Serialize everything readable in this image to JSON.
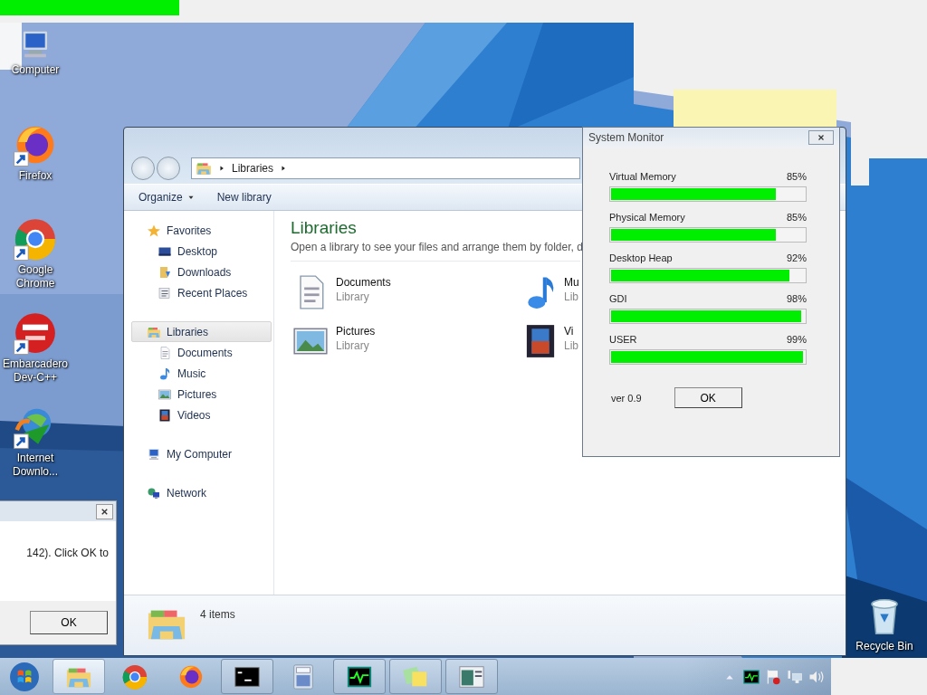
{
  "desktop_icons": [
    {
      "label": "Computer",
      "kind": "computer",
      "shortcut": false
    },
    {
      "label": "Firefox",
      "kind": "firefox",
      "shortcut": true
    },
    {
      "label": "Google Chrome",
      "kind": "chrome",
      "shortcut": true
    },
    {
      "label": "Embarcadero Dev-C++",
      "kind": "devcpp",
      "shortcut": true
    },
    {
      "label": "Internet Downlo...",
      "kind": "idm",
      "shortcut": true
    },
    {
      "label": "Recycle Bin",
      "kind": "recycle",
      "shortcut": false
    }
  ],
  "explorer": {
    "breadcrumb": [
      "Libraries"
    ],
    "toolbar": [
      {
        "label": "Organize",
        "dropdown": true
      },
      {
        "label": "New library",
        "dropdown": false
      }
    ],
    "nav": [
      {
        "label": "Favorites",
        "kind": "star",
        "selected": false,
        "children": [
          {
            "label": "Desktop",
            "kind": "desktop",
            "selected": false
          },
          {
            "label": "Downloads",
            "kind": "downloads",
            "selected": false
          },
          {
            "label": "Recent Places",
            "kind": "recent",
            "selected": false
          }
        ]
      },
      {
        "label": "Libraries",
        "kind": "library",
        "selected": true,
        "children": [
          {
            "label": "Documents",
            "kind": "document",
            "selected": false
          },
          {
            "label": "Music",
            "kind": "music",
            "selected": false
          },
          {
            "label": "Pictures",
            "kind": "pictures",
            "selected": false
          },
          {
            "label": "Videos",
            "kind": "videos",
            "selected": false
          }
        ]
      },
      {
        "label": "My Computer",
        "kind": "mycomputer",
        "selected": false
      },
      {
        "label": "Network",
        "kind": "network",
        "selected": false
      }
    ],
    "title": "Libraries",
    "subtitle": "Open a library to see your files and arrange them by folder, d",
    "items": [
      {
        "name": "Documents",
        "type": "Library",
        "kind": "document"
      },
      {
        "name": "Mu",
        "type": "Lib",
        "kind": "music"
      },
      {
        "name": "Pictures",
        "type": "Library",
        "kind": "pictures"
      },
      {
        "name": "Vi",
        "type": "Lib",
        "kind": "videos"
      }
    ],
    "status": "4 items"
  },
  "system_monitor": {
    "title": "System Monitor",
    "meters": [
      {
        "name": "Virtual Memory",
        "reading": "85%",
        "level": 0.85
      },
      {
        "name": "Physical Memory",
        "reading": "85%",
        "level": 0.85
      },
      {
        "name": "Desktop Heap",
        "reading": "92%",
        "level": 0.92
      },
      {
        "name": "GDI",
        "reading": "98%",
        "level": 0.98
      },
      {
        "name": "USER",
        "reading": "99%",
        "level": 0.99
      }
    ],
    "version": "ver 0.9",
    "button": "OK"
  },
  "dialog": {
    "message": "142). Click OK to",
    "button": "OK"
  },
  "taskbar": {
    "items": [
      {
        "kind": "folder",
        "selected": true,
        "running": true
      },
      {
        "kind": "chrome",
        "selected": false,
        "running": false
      },
      {
        "kind": "firefox",
        "selected": false,
        "running": false
      },
      {
        "kind": "cmd",
        "selected": false,
        "running": true
      },
      {
        "kind": "calculator",
        "selected": false,
        "running": false
      },
      {
        "kind": "monitor",
        "selected": false,
        "running": true
      },
      {
        "kind": "notes",
        "selected": false,
        "running": true
      },
      {
        "kind": "window",
        "selected": false,
        "running": true
      }
    ],
    "tray": [
      {
        "kind": "arrow"
      },
      {
        "kind": "monitor"
      },
      {
        "kind": "flag"
      },
      {
        "kind": "network"
      },
      {
        "kind": "volume"
      }
    ]
  }
}
